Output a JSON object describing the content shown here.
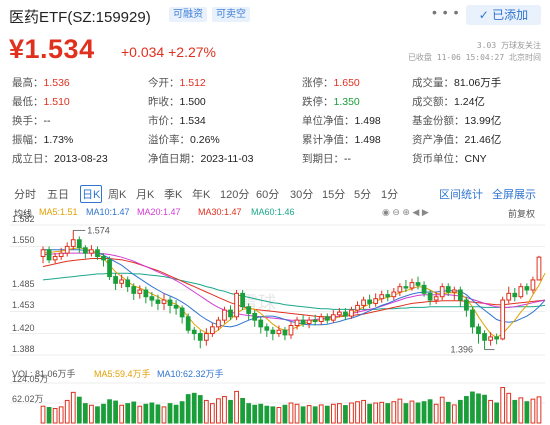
{
  "header": {
    "title": "医药ETF(SZ:159929)",
    "tags": [
      "可融资",
      "可卖空"
    ],
    "more": "• • •",
    "add_button": "✓ 已添加"
  },
  "quote": {
    "price": "¥1.534",
    "change": "+0.034",
    "change_pct": "+2.27%",
    "followers": "3.03 万球友关注",
    "status": "已收盘 11-06 15:04:27 北京时间"
  },
  "stats": [
    [
      {
        "k": "最高：",
        "v": "1.536",
        "c": "red"
      },
      {
        "k": "今开：",
        "v": "1.512",
        "c": "red"
      },
      {
        "k": "涨停：",
        "v": "1.650",
        "c": "red"
      },
      {
        "k": "成交量：",
        "v": "81.06万手",
        "c": ""
      }
    ],
    [
      {
        "k": "最低：",
        "v": "1.510",
        "c": "red"
      },
      {
        "k": "昨收：",
        "v": "1.500",
        "c": ""
      },
      {
        "k": "跌停：",
        "v": "1.350",
        "c": "green"
      },
      {
        "k": "成交额：",
        "v": "1.24亿",
        "c": ""
      }
    ],
    [
      {
        "k": "换手：",
        "v": "--",
        "c": ""
      },
      {
        "k": "市价：",
        "v": "1.534",
        "c": ""
      },
      {
        "k": "单位净值：",
        "v": "1.498",
        "c": ""
      },
      {
        "k": "基金份额：",
        "v": "13.99亿",
        "c": ""
      }
    ],
    [
      {
        "k": "振幅：",
        "v": "1.73%",
        "c": ""
      },
      {
        "k": "溢价率：",
        "v": "0.26%",
        "c": ""
      },
      {
        "k": "累计净值：",
        "v": "1.498",
        "c": ""
      },
      {
        "k": "资产净值：",
        "v": "21.46亿",
        "c": ""
      }
    ],
    [
      {
        "k": "成立日：",
        "v": "2013-08-23",
        "c": ""
      },
      {
        "k": "净值日期：",
        "v": "2023-11-03",
        "c": ""
      },
      {
        "k": "到期日：",
        "v": "--",
        "c": ""
      },
      {
        "k": "货币单位：",
        "v": "CNY",
        "c": ""
      }
    ]
  ],
  "tabs": [
    "分时",
    "五日",
    "日K",
    "周K",
    "月K",
    "季K",
    "年K",
    "120分",
    "60分",
    "30分",
    "15分",
    "5分",
    "1分"
  ],
  "active_tab": "日K",
  "tab_links": [
    "区间统计",
    "全屏展示"
  ],
  "chart_legend": {
    "label": "均线",
    "ma": [
      {
        "name": "MA5:1.51",
        "color": "#e0a000"
      },
      {
        "name": "MA10:1.47",
        "color": "#2f74d0"
      },
      {
        "name": "MA20:1.47",
        "color": "#d23bd3"
      },
      {
        "name": "MA30:1.47",
        "color": "#e0301e"
      },
      {
        "name": "MA60:1.46",
        "color": "#1aa88a"
      }
    ],
    "adjust": "前复权"
  },
  "chart_data": {
    "type": "candlestick",
    "y_ticks": [
      "1.582",
      "1.550",
      "1.485",
      "1.453",
      "1.420",
      "1.388"
    ],
    "ylim": [
      1.388,
      1.582
    ],
    "high_marker": "1.574",
    "low_marker": "1.396",
    "watermark": "雪球",
    "candles": [
      [
        1.535,
        1.545,
        1.55,
        1.525
      ],
      [
        1.545,
        1.53,
        1.55,
        1.525
      ],
      [
        1.53,
        1.535,
        1.54,
        1.525
      ],
      [
        1.535,
        1.54,
        1.548,
        1.53
      ],
      [
        1.54,
        1.55,
        1.556,
        1.535
      ],
      [
        1.55,
        1.56,
        1.574,
        1.545
      ],
      [
        1.56,
        1.548,
        1.565,
        1.54
      ],
      [
        1.548,
        1.54,
        1.552,
        1.532
      ],
      [
        1.54,
        1.545,
        1.552,
        1.535
      ],
      [
        1.545,
        1.535,
        1.55,
        1.53
      ],
      [
        1.535,
        1.53,
        1.54,
        1.52
      ],
      [
        1.53,
        1.505,
        1.535,
        1.5
      ],
      [
        1.505,
        1.495,
        1.51,
        1.485
      ],
      [
        1.495,
        1.5,
        1.508,
        1.488
      ],
      [
        1.5,
        1.49,
        1.505,
        1.482
      ],
      [
        1.49,
        1.48,
        1.495,
        1.47
      ],
      [
        1.48,
        1.485,
        1.492,
        1.472
      ],
      [
        1.485,
        1.475,
        1.49,
        1.465
      ],
      [
        1.475,
        1.47,
        1.482,
        1.46
      ],
      [
        1.47,
        1.465,
        1.478,
        1.455
      ],
      [
        1.465,
        1.47,
        1.48,
        1.455
      ],
      [
        1.47,
        1.462,
        1.475,
        1.45
      ],
      [
        1.462,
        1.458,
        1.47,
        1.448
      ],
      [
        1.458,
        1.445,
        1.462,
        1.435
      ],
      [
        1.445,
        1.425,
        1.45,
        1.42
      ],
      [
        1.425,
        1.42,
        1.43,
        1.41
      ],
      [
        1.42,
        1.41,
        1.425,
        1.398
      ],
      [
        1.41,
        1.42,
        1.428,
        1.402
      ],
      [
        1.42,
        1.43,
        1.436,
        1.415
      ],
      [
        1.43,
        1.44,
        1.445,
        1.425
      ],
      [
        1.44,
        1.455,
        1.46,
        1.435
      ],
      [
        1.455,
        1.445,
        1.462,
        1.44
      ],
      [
        1.445,
        1.48,
        1.485,
        1.44
      ],
      [
        1.48,
        1.46,
        1.485,
        1.455
      ],
      [
        1.46,
        1.45,
        1.465,
        1.44
      ],
      [
        1.45,
        1.44,
        1.455,
        1.43
      ],
      [
        1.44,
        1.43,
        1.445,
        1.42
      ],
      [
        1.43,
        1.425,
        1.435,
        1.415
      ],
      [
        1.425,
        1.42,
        1.43,
        1.41
      ],
      [
        1.42,
        1.425,
        1.432,
        1.415
      ],
      [
        1.425,
        1.418,
        1.43,
        1.41
      ],
      [
        1.418,
        1.432,
        1.438,
        1.412
      ],
      [
        1.432,
        1.44,
        1.445,
        1.426
      ],
      [
        1.44,
        1.435,
        1.448,
        1.43
      ],
      [
        1.435,
        1.44,
        1.445,
        1.428
      ],
      [
        1.44,
        1.438,
        1.448,
        1.432
      ],
      [
        1.438,
        1.445,
        1.45,
        1.433
      ],
      [
        1.445,
        1.44,
        1.45,
        1.435
      ],
      [
        1.44,
        1.448,
        1.455,
        1.436
      ],
      [
        1.448,
        1.452,
        1.458,
        1.444
      ],
      [
        1.452,
        1.446,
        1.458,
        1.44
      ],
      [
        1.446,
        1.455,
        1.46,
        1.442
      ],
      [
        1.455,
        1.462,
        1.468,
        1.45
      ],
      [
        1.462,
        1.47,
        1.475,
        1.456
      ],
      [
        1.47,
        1.465,
        1.478,
        1.458
      ],
      [
        1.465,
        1.472,
        1.48,
        1.46
      ],
      [
        1.472,
        1.478,
        1.484,
        1.466
      ],
      [
        1.478,
        1.475,
        1.485,
        1.468
      ],
      [
        1.475,
        1.482,
        1.488,
        1.47
      ],
      [
        1.482,
        1.49,
        1.495,
        1.476
      ],
      [
        1.49,
        1.488,
        1.5,
        1.482
      ],
      [
        1.488,
        1.496,
        1.502,
        1.484
      ],
      [
        1.496,
        1.492,
        1.505,
        1.486
      ],
      [
        1.492,
        1.48,
        1.498,
        1.475
      ],
      [
        1.48,
        1.47,
        1.485,
        1.462
      ],
      [
        1.47,
        1.475,
        1.482,
        1.464
      ],
      [
        1.475,
        1.49,
        1.495,
        1.47
      ],
      [
        1.49,
        1.482,
        1.495,
        1.476
      ],
      [
        1.482,
        1.485,
        1.49,
        1.47
      ],
      [
        1.485,
        1.47,
        1.49,
        1.46
      ],
      [
        1.47,
        1.455,
        1.475,
        1.445
      ],
      [
        1.455,
        1.43,
        1.46,
        1.42
      ],
      [
        1.43,
        1.42,
        1.435,
        1.405
      ],
      [
        1.42,
        1.41,
        1.425,
        1.396
      ],
      [
        1.41,
        1.415,
        1.422,
        1.402
      ],
      [
        1.415,
        1.412,
        1.42,
        1.404
      ],
      [
        1.412,
        1.47,
        1.475,
        1.41
      ],
      [
        1.47,
        1.48,
        1.49,
        1.465
      ],
      [
        1.48,
        1.475,
        1.488,
        1.468
      ],
      [
        1.475,
        1.49,
        1.495,
        1.472
      ],
      [
        1.49,
        1.485,
        1.495,
        1.478
      ],
      [
        1.485,
        1.5,
        1.505,
        1.48
      ],
      [
        1.5,
        1.534,
        1.536,
        1.51
      ]
    ],
    "ma5": [
      1.54,
      1.541,
      1.542,
      1.543,
      1.545,
      1.547,
      1.548,
      1.546,
      1.544,
      1.54,
      1.532,
      1.522,
      1.512,
      1.505,
      1.498,
      1.491,
      1.488,
      1.484,
      1.479,
      1.475,
      1.47,
      1.467,
      1.464,
      1.456,
      1.445,
      1.434,
      1.426,
      1.421,
      1.42,
      1.425,
      1.434,
      1.441,
      1.45,
      1.456,
      1.458,
      1.456,
      1.45,
      1.442,
      1.434,
      1.428,
      1.425,
      1.426,
      1.43,
      1.434,
      1.438,
      1.44,
      1.44,
      1.441,
      1.442,
      1.445,
      1.448,
      1.45,
      1.455,
      1.46,
      1.464,
      1.468,
      1.472,
      1.474,
      1.477,
      1.481,
      1.484,
      1.487,
      1.49,
      1.489,
      1.485,
      1.48,
      1.479,
      1.481,
      1.481,
      1.48,
      1.472,
      1.46,
      1.445,
      1.432,
      1.42,
      1.414,
      1.42,
      1.43,
      1.44,
      1.452,
      1.462,
      1.478,
      1.492,
      1.51
    ],
    "ma10": [
      1.545,
      1.545,
      1.545,
      1.545,
      1.545,
      1.545,
      1.545,
      1.544,
      1.543,
      1.541,
      1.537,
      1.532,
      1.527,
      1.522,
      1.515,
      1.508,
      1.502,
      1.496,
      1.49,
      1.485,
      1.48,
      1.476,
      1.472,
      1.467,
      1.461,
      1.454,
      1.447,
      1.441,
      1.436,
      1.433,
      1.431,
      1.43,
      1.432,
      1.436,
      1.44,
      1.443,
      1.445,
      1.446,
      1.446,
      1.444,
      1.441,
      1.438,
      1.436,
      1.434,
      1.433,
      1.433,
      1.433,
      1.434,
      1.436,
      1.438,
      1.441,
      1.443,
      1.446,
      1.45,
      1.454,
      1.458,
      1.462,
      1.465,
      1.469,
      1.473,
      1.476,
      1.479,
      1.481,
      1.482,
      1.482,
      1.482,
      1.483,
      1.484,
      1.484,
      1.483,
      1.478,
      1.47,
      1.462,
      1.455,
      1.448,
      1.441,
      1.438,
      1.437,
      1.438,
      1.442,
      1.446,
      1.452,
      1.46,
      1.47
    ],
    "ma20": [
      1.538,
      1.538,
      1.539,
      1.539,
      1.54,
      1.54,
      1.54,
      1.54,
      1.54,
      1.54,
      1.539,
      1.538,
      1.536,
      1.534,
      1.531,
      1.528,
      1.524,
      1.52,
      1.516,
      1.512,
      1.508,
      1.504,
      1.499,
      1.494,
      1.488,
      1.482,
      1.476,
      1.47,
      1.464,
      1.459,
      1.455,
      1.452,
      1.45,
      1.448,
      1.447,
      1.446,
      1.445,
      1.444,
      1.443,
      1.442,
      1.441,
      1.44,
      1.44,
      1.44,
      1.44,
      1.441,
      1.442,
      1.443,
      1.444,
      1.446,
      1.448,
      1.45,
      1.452,
      1.454,
      1.456,
      1.458,
      1.461,
      1.464,
      1.467,
      1.47,
      1.473,
      1.475,
      1.477,
      1.478,
      1.478,
      1.478,
      1.478,
      1.478,
      1.477,
      1.476,
      1.474,
      1.471,
      1.468,
      1.465,
      1.462,
      1.46,
      1.459,
      1.459,
      1.46,
      1.462,
      1.464,
      1.466,
      1.468,
      1.47
    ],
    "ma30": [
      1.52,
      1.522,
      1.524,
      1.526,
      1.528,
      1.529,
      1.53,
      1.531,
      1.532,
      1.532,
      1.532,
      1.532,
      1.531,
      1.53,
      1.528,
      1.526,
      1.523,
      1.52,
      1.517,
      1.514,
      1.51,
      1.506,
      1.502,
      1.498,
      1.494,
      1.49,
      1.486,
      1.482,
      1.478,
      1.474,
      1.47,
      1.466,
      1.463,
      1.46,
      1.458,
      1.456,
      1.455,
      1.454,
      1.453,
      1.452,
      1.451,
      1.45,
      1.449,
      1.448,
      1.447,
      1.446,
      1.445,
      1.445,
      1.445,
      1.445,
      1.446,
      1.447,
      1.448,
      1.449,
      1.451,
      1.453,
      1.455,
      1.457,
      1.459,
      1.461,
      1.463,
      1.465,
      1.466,
      1.467,
      1.468,
      1.468,
      1.469,
      1.469,
      1.469,
      1.469,
      1.468,
      1.467,
      1.466,
      1.465,
      1.464,
      1.463,
      1.463,
      1.464,
      1.465,
      1.466,
      1.467,
      1.468,
      1.469,
      1.47
    ],
    "ma60": [
      1.5,
      1.501,
      1.502,
      1.503,
      1.504,
      1.505,
      1.506,
      1.507,
      1.508,
      1.509,
      1.509,
      1.51,
      1.51,
      1.51,
      1.51,
      1.509,
      1.509,
      1.508,
      1.507,
      1.506,
      1.505,
      1.503,
      1.501,
      1.499,
      1.497,
      1.495,
      1.493,
      1.49,
      1.488,
      1.485,
      1.483,
      1.48,
      1.478,
      1.476,
      1.474,
      1.472,
      1.47,
      1.468,
      1.466,
      1.465,
      1.463,
      1.462,
      1.461,
      1.46,
      1.459,
      1.458,
      1.457,
      1.457,
      1.456,
      1.456,
      1.456,
      1.456,
      1.456,
      1.456,
      1.456,
      1.456,
      1.457,
      1.457,
      1.457,
      1.458,
      1.458,
      1.459,
      1.459,
      1.459,
      1.46,
      1.46,
      1.46,
      1.46,
      1.46,
      1.46,
      1.46,
      1.46,
      1.46,
      1.459,
      1.459,
      1.459,
      1.459,
      1.459,
      1.46,
      1.46,
      1.46,
      1.46,
      1.461,
      1.462
    ]
  },
  "volume_legend": {
    "vol": {
      "text": "VOL: 81.06万手",
      "color": "#555"
    },
    "ma5": {
      "text": "MA5:59.4万手",
      "color": "#e0a000"
    },
    "ma10": {
      "text": "MA10:62.32万手",
      "color": "#2f74d0"
    }
  },
  "volume_data": {
    "y_ticks": [
      "124.05万",
      "62.02万"
    ],
    "max": 124.05,
    "values": [
      52,
      48,
      45,
      50,
      70,
      95,
      80,
      60,
      55,
      50,
      58,
      72,
      68,
      55,
      60,
      65,
      52,
      58,
      62,
      56,
      50,
      60,
      55,
      66,
      88,
      92,
      85,
      70,
      60,
      75,
      82,
      70,
      98,
      76,
      60,
      55,
      58,
      52,
      50,
      48,
      55,
      62,
      58,
      50,
      54,
      50,
      56,
      52,
      58,
      60,
      54,
      62,
      66,
      70,
      58,
      62,
      64,
      60,
      66,
      74,
      60,
      68,
      62,
      66,
      72,
      58,
      80,
      64,
      56,
      70,
      82,
      96,
      90,
      86,
      70,
      62,
      110,
      92,
      70,
      78,
      66,
      74,
      81
    ]
  }
}
